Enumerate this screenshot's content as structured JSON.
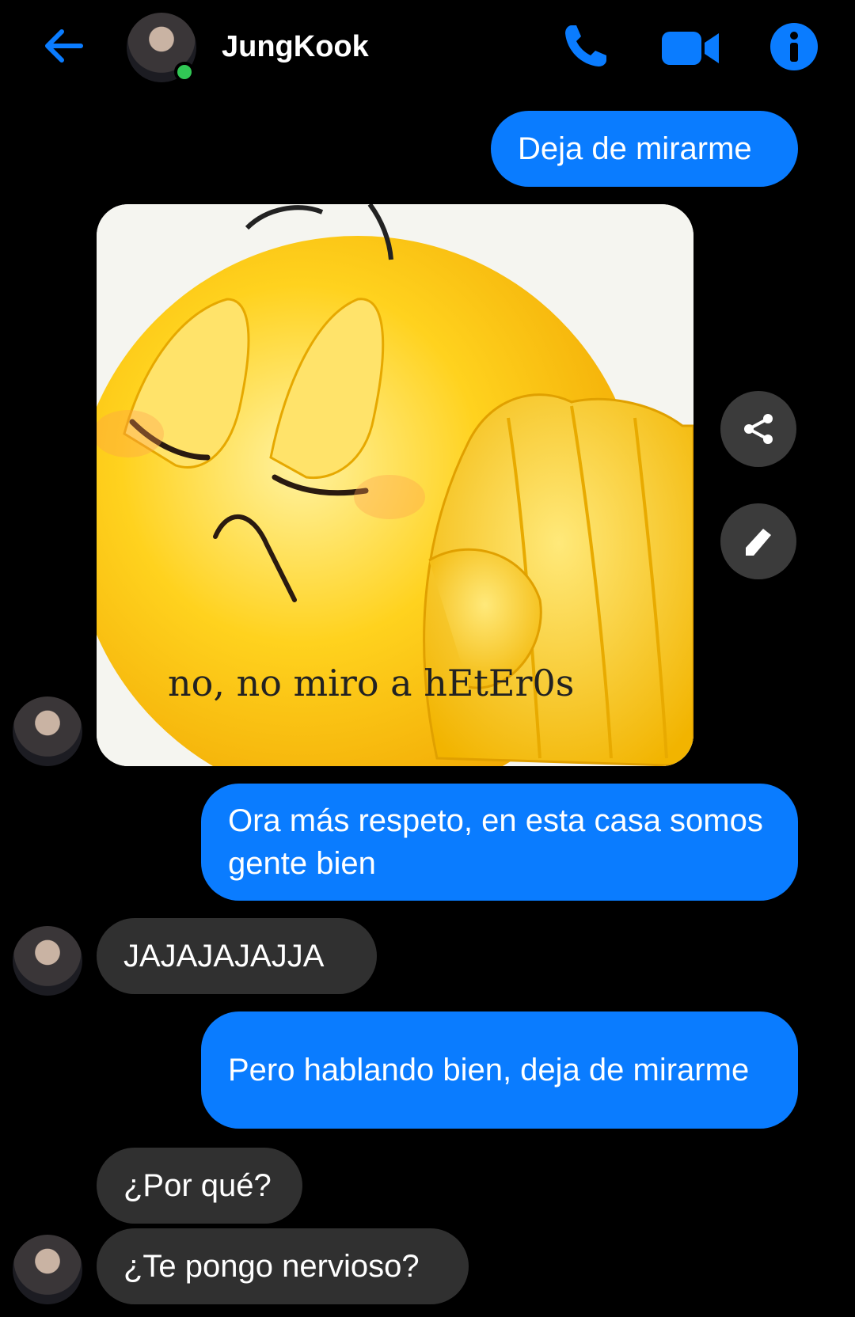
{
  "header": {
    "contact_name": "JungKook",
    "online": true,
    "icons": [
      "back-arrow-icon",
      "phone-icon",
      "video-camera-icon",
      "info-icon"
    ],
    "accent_color": "#0a7cff"
  },
  "messages": [
    {
      "from": "me",
      "text": "Deja de mirarme"
    },
    {
      "from": "them",
      "type": "image",
      "caption_text": "no, no miro a hEtEr0s"
    },
    {
      "from": "me",
      "text": "Ora más respeto, en esta casa somos gente bien"
    },
    {
      "from": "them",
      "text": "JAJAJAJAJJA"
    },
    {
      "from": "me",
      "text": "Pero hablando bien, deja de mirarme"
    },
    {
      "from": "them",
      "text": "¿Por qué?"
    },
    {
      "from": "them",
      "text": "¿Te pongo nervioso?"
    }
  ],
  "colors": {
    "outgoing_bubble": "#0a7cff",
    "incoming_bubble": "#303030",
    "background": "#000000",
    "online_dot": "#31c755"
  }
}
